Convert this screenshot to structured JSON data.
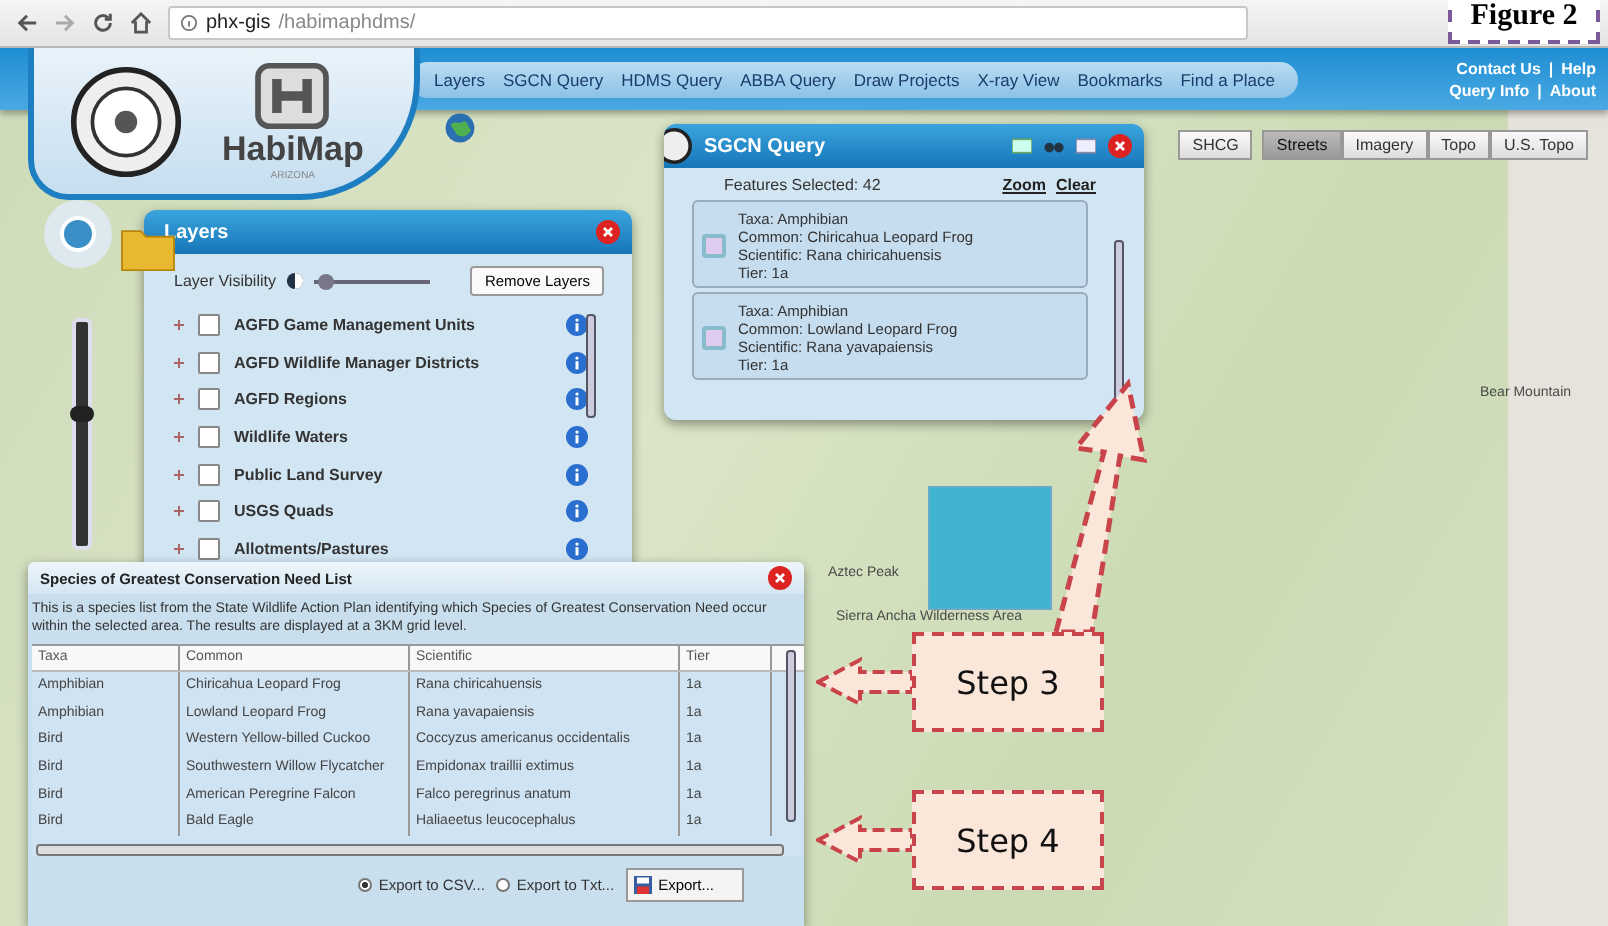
{
  "browser": {
    "url_host": "phx-gis",
    "url_path": "/habimaphdms/"
  },
  "figure_label": "Figure 2",
  "header": {
    "logo_text": "HabiMap",
    "logo_subtext": "ARIZONA",
    "nav": [
      "Layers",
      "SGCN Query",
      "HDMS Query",
      "ABBA Query",
      "Draw Projects",
      "X-ray View",
      "Bookmarks",
      "Find a Place"
    ],
    "link_rows": [
      {
        "links": [
          "Contact Us",
          "Help"
        ]
      },
      {
        "links": [
          "Query Info",
          "About"
        ]
      }
    ],
    "separator": "|"
  },
  "basemaps": [
    {
      "label": "SHCG",
      "selected": false
    },
    {
      "label": "Streets",
      "selected": true
    },
    {
      "label": "Imagery",
      "selected": false
    },
    {
      "label": "Topo",
      "selected": false
    },
    {
      "label": "U.S. Topo",
      "selected": false
    }
  ],
  "zoom_slider": {
    "level": 0.6
  },
  "map_labels": [
    "Bear Mountain",
    "Aztec Peak",
    "Sierra Ancha Wilderness Area"
  ],
  "layers_panel": {
    "title": "Layers",
    "visibility_label": "Layer Visibility",
    "visibility": {
      "level": 0.05
    },
    "remove_button": "Remove Layers",
    "items": [
      {
        "label": "AGFD Game Management Units",
        "checked": false
      },
      {
        "label": "AGFD Wildlife Manager Districts",
        "checked": false
      },
      {
        "label": "AGFD Regions",
        "checked": false
      },
      {
        "label": "Wildlife Waters",
        "checked": false
      },
      {
        "label": "Public Land Survey",
        "checked": false
      },
      {
        "label": "USGS Quads",
        "checked": false
      },
      {
        "label": "Allotments/Pastures",
        "checked": false
      }
    ]
  },
  "sgcn_query": {
    "title": "SGCN Query",
    "features": "Features Selected: 42",
    "zoom": "Zoom",
    "clear": "Clear",
    "results": [
      {
        "lines": [
          "Taxa: Amphibian",
          "Common: Chiricahua Leopard Frog",
          "Scientific: Rana chiricahuensis",
          "Tier: 1a"
        ]
      },
      {
        "lines": [
          "Taxa: Amphibian",
          "Common: Lowland Leopard Frog",
          "Scientific: Rana yavapaiensis",
          "Tier: 1a"
        ]
      }
    ]
  },
  "species_panel": {
    "title": "Species of Greatest Conservation Need List",
    "description": "This is a species list from the State Wildlife Action Plan identifying which Species of Greatest Conservation Need occur within the selected area. The results are displayed at a 3KM grid level.",
    "columns": [
      "Taxa",
      "Common",
      "Scientific",
      "Tier"
    ],
    "rows": [
      [
        "Amphibian",
        "Chiricahua Leopard Frog",
        "Rana chiricahuensis",
        "1a"
      ],
      [
        "Amphibian",
        "Lowland Leopard Frog",
        "Rana yavapaiensis",
        "1a"
      ],
      [
        "Bird",
        "Western Yellow-billed Cuckoo",
        "Coccyzus americanus occidentalis",
        "1a"
      ],
      [
        "Bird",
        "Southwestern Willow Flycatcher",
        "Empidonax traillii extimus",
        "1a"
      ],
      [
        "Bird",
        "American Peregrine Falcon",
        "Falco peregrinus anatum",
        "1a"
      ],
      [
        "Bird",
        "Bald Eagle",
        "Haliaeetus leucocephalus",
        "1a"
      ]
    ],
    "export_options": [
      {
        "label": "Export to CSV...",
        "selected": true
      },
      {
        "label": "Export to Txt...",
        "selected": false
      }
    ],
    "export_button": "Export..."
  },
  "annotations": [
    {
      "label": "Step 3"
    },
    {
      "label": "Step 4"
    }
  ]
}
